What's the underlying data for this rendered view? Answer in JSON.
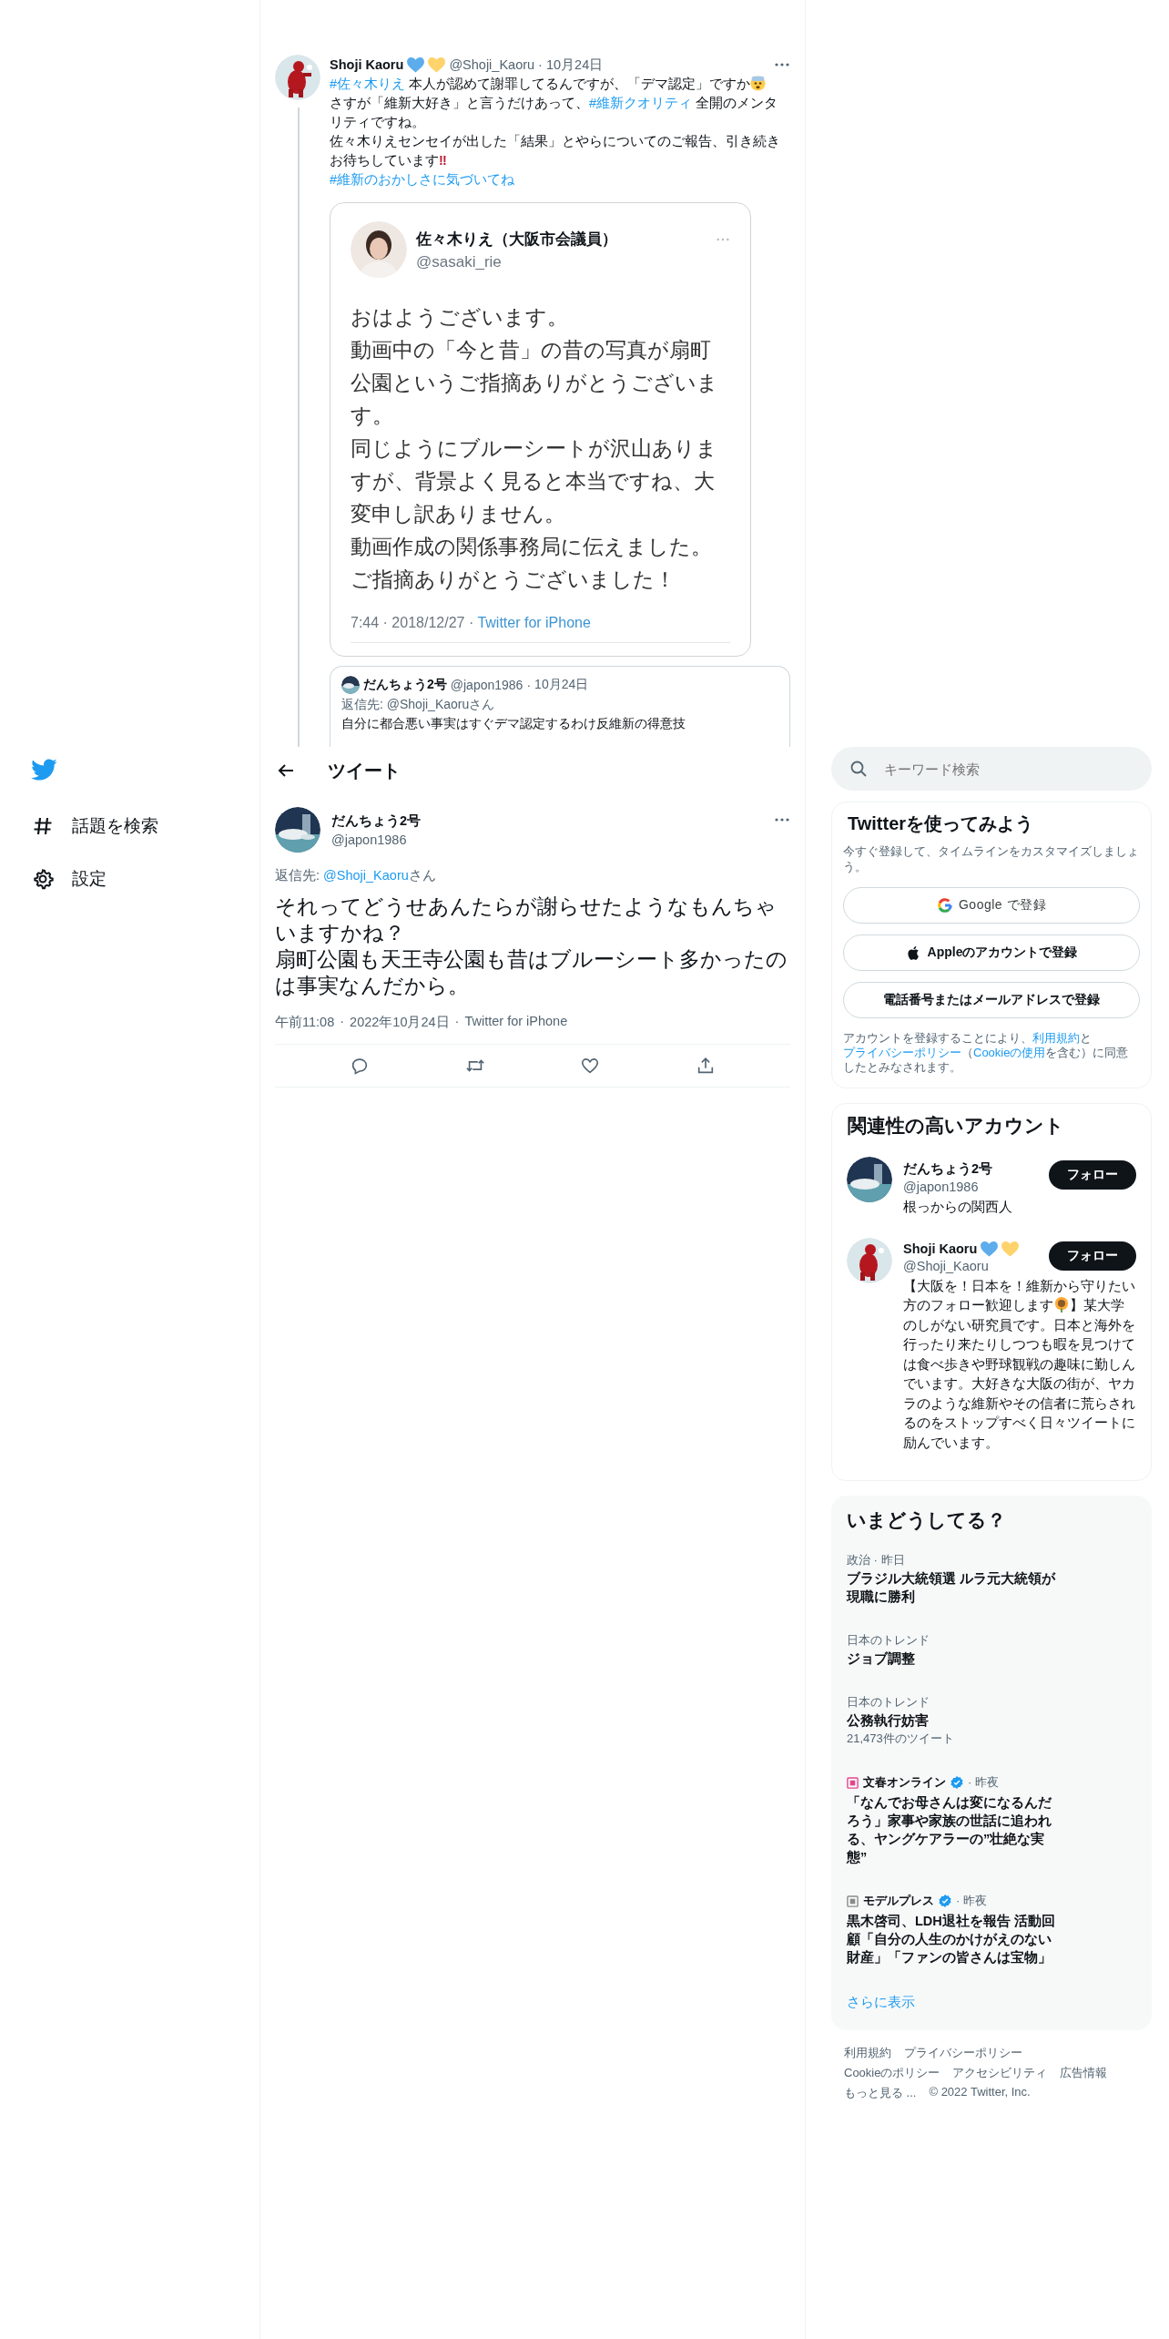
{
  "nav": {
    "items": [
      {
        "kind": "hash",
        "label": "話題を検索"
      },
      {
        "kind": "gear",
        "label": "設定"
      }
    ]
  },
  "thread_tweet": {
    "name": "Shoji Kaoru",
    "name_marks": [
      {
        "kind": "heart",
        "color": "#5dadec"
      },
      {
        "kind": "heart",
        "color": "#ffd36b"
      }
    ],
    "handle": "@Shoji_Kaoru",
    "separator": "·",
    "date": "10月24日",
    "paragraphs": [
      [
        {
          "kind": "link",
          "text": "#佐々木りえ"
        },
        {
          "kind": "text",
          "text": " 本人が認めて謝罪してるんですが、「デマ認定」ですか"
        },
        {
          "kind": "worried-face"
        }
      ],
      [
        {
          "kind": "text",
          "text": "さすが「維新大好き」と言うだけあって、"
        },
        {
          "kind": "link",
          "text": "#維新クオリティ"
        },
        {
          "kind": "text",
          "text": " 全開のメンタリティですね。"
        }
      ],
      [
        {
          "kind": "text",
          "text": "佐々木りえセンセイが出した「結果」とやらについてのご報告、引き続きお待ちしています"
        },
        {
          "kind": "alert",
          "text": "‼"
        }
      ],
      [
        {
          "kind": "link",
          "text": "#維新のおかしさに気づいてね"
        }
      ]
    ],
    "image": {
      "name": "佐々木りえ（大阪市会議員）",
      "handle": "@sasaki_rie",
      "paragraphs": [
        "おはようございます。",
        "動画中の「今と昔」の昔の写真が扇町公園というご指摘ありがとうございます。",
        "同じようにブルーシートが沢山ありますが、背景よく見ると本当ですね、大変申し訳ありません。",
        "動画作成の関係事務局に伝えました。",
        "ご指摘ありがとうございました！"
      ],
      "meta": "7:44 · 2018/12/27 · ",
      "source": "Twitter for iPhone"
    },
    "quoted": {
      "name": "だんちょう2号",
      "handle": "@japon1986",
      "separator": "·",
      "date": "10月24日",
      "reply_prefix": "返信先: ",
      "reply_to": "@Shoji_Kaoru",
      "reply_suffix": "さん",
      "text": "自分に都合悪い事実はすぐデマ認定するわけ反維新の得意技"
    }
  },
  "header": {
    "title": "ツイート"
  },
  "tweet": {
    "name": "だんちょう2号",
    "handle": "@japon1986",
    "reply_prefix": "返信先: ",
    "reply_to": "@Shoji_Kaoru",
    "reply_suffix": "さん",
    "paragraphs": [
      "それってどうせあんたらが謝らせたようなもんちゃいますかね？",
      "扇町公園も天王寺公園も昔はブルーシート多かったのは事実なんだから。"
    ],
    "meta": [
      "午前11:08",
      "·",
      "2022年10月24日",
      "·",
      "Twitter for iPhone"
    ],
    "actions": [
      {
        "kind": "reply"
      },
      {
        "kind": "retweet"
      },
      {
        "kind": "like"
      },
      {
        "kind": "share"
      }
    ]
  },
  "search": {
    "placeholder": "キーワード検索"
  },
  "signup": {
    "title": "Twitterを使ってみよう",
    "subtitle": "今すぐ登録して、タイムラインをカスタマイズしましょう。",
    "buttons": [
      {
        "kind": "google",
        "label": "Google で登録"
      },
      {
        "kind": "apple",
        "label": "Appleのアカウントで登録"
      },
      {
        "kind": "plain",
        "label": "電話番号またはメールアドレスで登録"
      }
    ],
    "legal": [
      {
        "kind": "text",
        "text": "アカウントを登録することにより、"
      },
      {
        "kind": "link",
        "text": "利用規約"
      },
      {
        "kind": "text",
        "text": "と"
      },
      {
        "kind": "link",
        "text": "プライバシーポリシー"
      },
      {
        "kind": "text",
        "text": "（"
      },
      {
        "kind": "link",
        "text": "Cookieの使用"
      },
      {
        "kind": "text",
        "text": "を含む）に同意したとみなされます。"
      }
    ]
  },
  "accounts": {
    "title": "関連性の高いアカウント",
    "items": [
      {
        "name": "だんちょう2号",
        "handle": "@japon1986",
        "bio": [
          {
            "kind": "text",
            "text": "根っからの関西人"
          }
        ],
        "button": "フォロー"
      },
      {
        "name": "Shoji Kaoru",
        "name_marks": [
          {
            "kind": "heart",
            "color": "#5dadec"
          },
          {
            "kind": "heart",
            "color": "#ffd36b"
          }
        ],
        "handle": "@Shoji_Kaoru",
        "bio": [
          {
            "kind": "text",
            "text": "【大阪を！日本を！維新から守りたい方のフォロー歓迎します"
          },
          {
            "kind": "sunflower"
          },
          {
            "kind": "text",
            "text": "】某大学のしがない研究員です。日本と海外を行ったり来たりしつつも暇を見つけては食べ歩きや野球観戦の趣味に勤しんでいます。大好きな大阪の街が、ヤカラのような維新やその信者に荒らされるのをストップすべく日々ツイートに励んでいます。"
          }
        ],
        "button": "フォロー"
      }
    ]
  },
  "trends": {
    "title": "いまどうしてる？",
    "items": [
      {
        "kind": "trend",
        "context": "政治 · 昨日",
        "title": "ブラジル大統領選 ルラ元大統領が現職に勝利"
      },
      {
        "kind": "trend",
        "context": "日本のトレンド",
        "title": "ジョブ調整"
      },
      {
        "kind": "trend",
        "context": "日本のトレンド",
        "title": "公務執行妨害",
        "count": "21,473件のツイート"
      },
      {
        "kind": "news",
        "source": "文春オンライン",
        "verified": true,
        "time": " · 昨夜",
        "title": "「なんでお母さんは変になるんだろう」家事や家族の世話に追われる、ヤングケアラーの”壮絶な実態”"
      },
      {
        "kind": "news",
        "source": "モデルプレス",
        "verified": true,
        "time": " · 昨夜",
        "title": "黒木啓司、LDH退社を報告 活動回顧「自分の人生のかけがえのない財産」「ファンの皆さんは宝物」"
      }
    ],
    "more": "さらに表示"
  },
  "footer": {
    "rows": [
      [
        "利用規約",
        "プライバシーポリシー"
      ],
      [
        "Cookieのポリシー",
        "アクセシビリティ",
        "広告情報"
      ],
      [
        "もっと見る ...",
        "© 2022 Twitter, Inc."
      ]
    ]
  }
}
